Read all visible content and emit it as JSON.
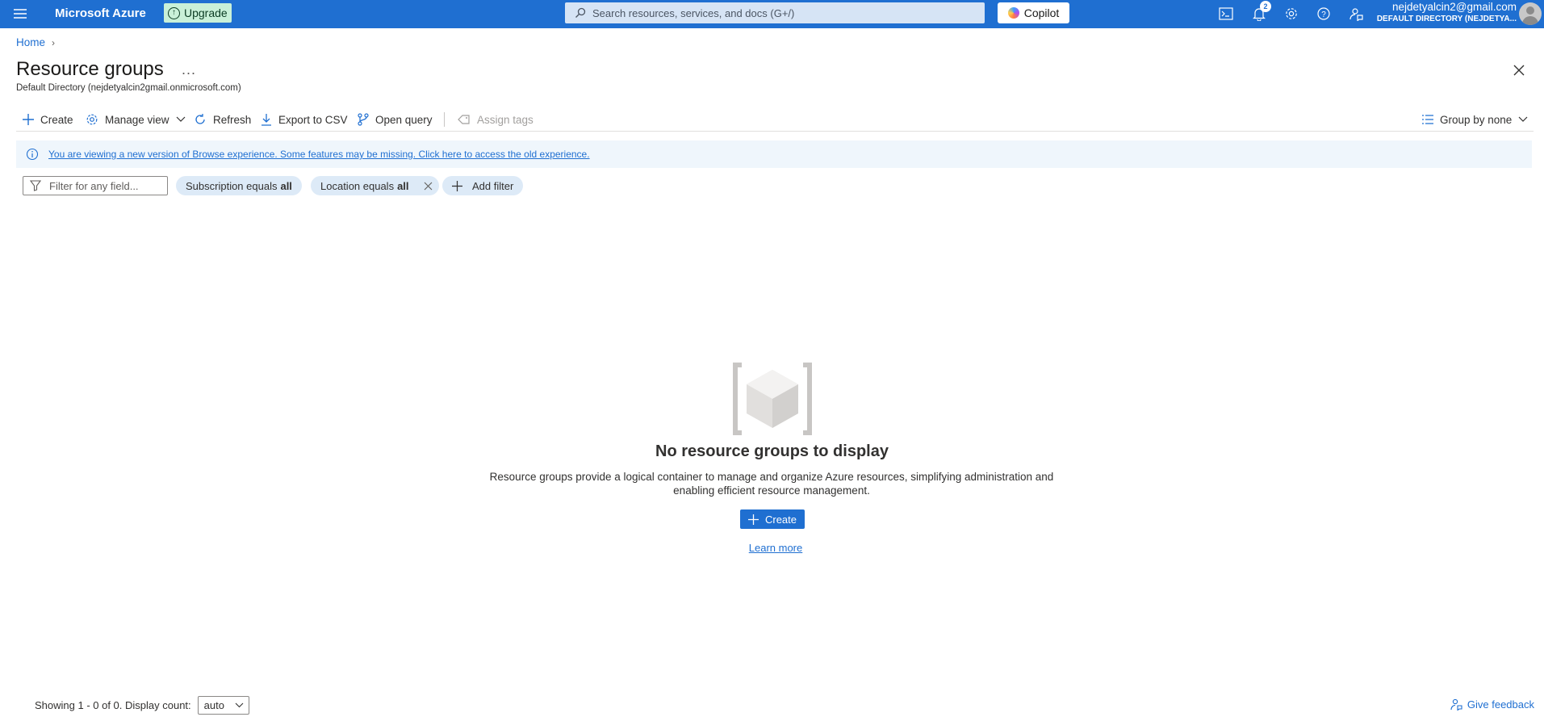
{
  "topbar": {
    "brand": "Microsoft Azure",
    "upgrade_label": "Upgrade",
    "search_placeholder": "Search resources, services, and docs (G+/)",
    "copilot_label": "Copilot",
    "notification_count": "2",
    "account_email": "nejdetyalcin2@gmail.com",
    "account_directory": "DEFAULT DIRECTORY (NEJDETYA..."
  },
  "breadcrumb": {
    "home": "Home"
  },
  "page": {
    "title": "Resource groups",
    "more": "...",
    "subtitle": "Default Directory (nejdetyalcin2gmail.onmicrosoft.com)"
  },
  "toolbar": {
    "create": "Create",
    "manage_view": "Manage view",
    "refresh": "Refresh",
    "export_csv": "Export to CSV",
    "open_query": "Open query",
    "assign_tags": "Assign tags",
    "group_by": "Group by none"
  },
  "infobar": {
    "message": "You are viewing a new version of Browse experience. Some features may be missing. Click here to access the old experience."
  },
  "filters": {
    "placeholder": "Filter for any field...",
    "subscription_prefix": "Subscription equals",
    "subscription_value": "all",
    "location_prefix": "Location equals",
    "location_value": "all",
    "add_filter": "Add filter"
  },
  "empty_state": {
    "title": "No resource groups to display",
    "description": "Resource groups provide a logical container to manage and organize Azure resources, simplifying administration and enabling efficient resource management.",
    "create_label": "Create",
    "learn_more": "Learn more"
  },
  "footer": {
    "showing": "Showing 1 - 0 of 0. Display count:",
    "display_count": "auto",
    "feedback": "Give feedback"
  },
  "colors": {
    "brand_blue": "#1f6fd1",
    "upgrade_green": "#c9f0d8",
    "info_background": "#eff6fc",
    "pill_background": "#ddeaf7"
  }
}
